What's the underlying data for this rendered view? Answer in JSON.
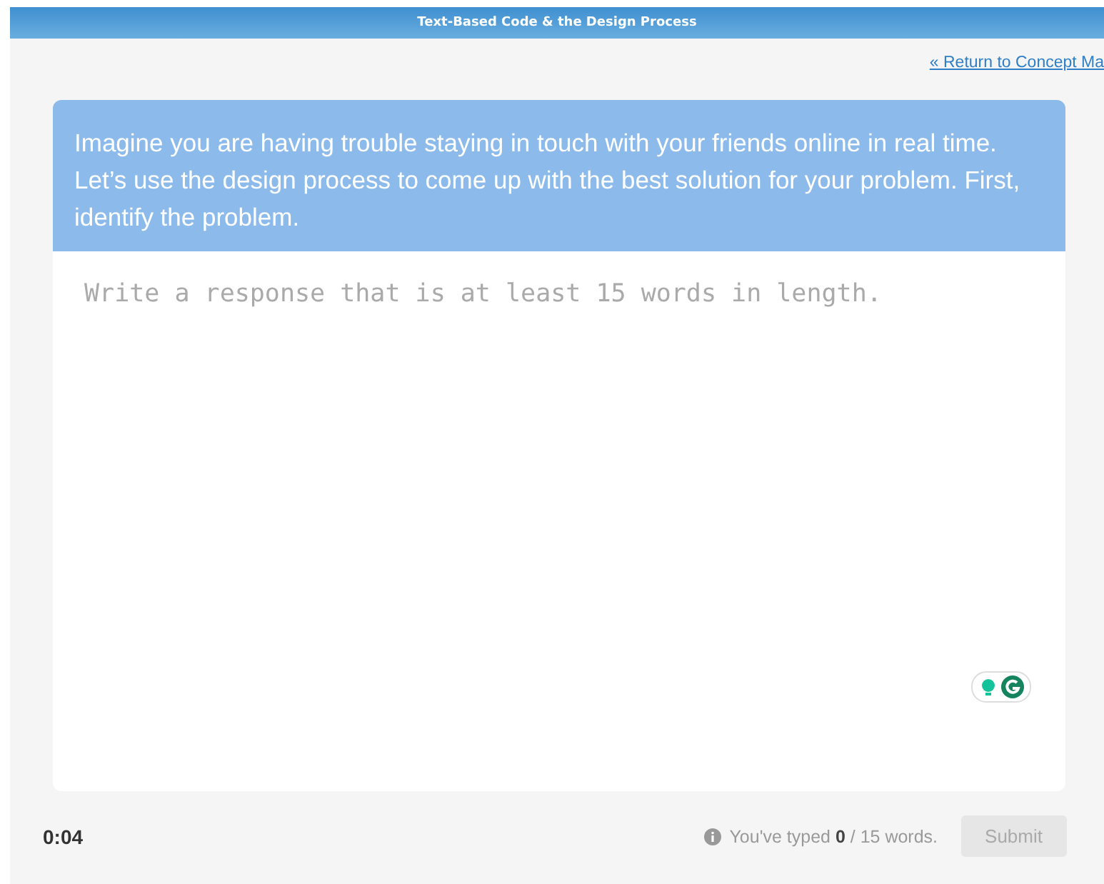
{
  "header": {
    "title": "Text-Based Code & the Design Process"
  },
  "return_link": "« Return to Concept Ma",
  "prompt": "Imagine you are having trouble staying in touch with your friends online in real time. Let’s use the design process to come up with the best solution for your problem. First, identify the problem.",
  "response": {
    "placeholder": "Write a response that is at least 15 words in length."
  },
  "footer": {
    "timer": "0:04",
    "word_count": "You've typed **0** / 15 words.",
    "submit": {
      "label": "Submit",
      "disabled": true
    }
  }
}
